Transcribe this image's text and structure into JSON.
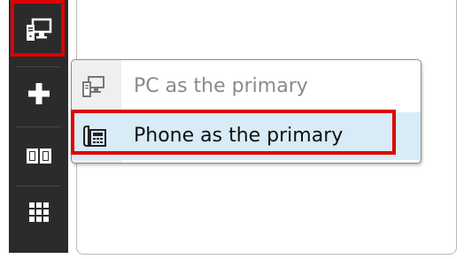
{
  "toolbar": {
    "items": [
      {
        "icon": "monitor-icon",
        "selected": true
      },
      {
        "icon": "plus-icon"
      },
      {
        "icon": "book-icon"
      },
      {
        "icon": "grid-icon"
      }
    ],
    "background": "#2b2b2b",
    "highlight_color": "#e00000"
  },
  "menu": {
    "items": [
      {
        "label": "PC as the primary",
        "icon": "pc-icon",
        "enabled": false
      },
      {
        "label": "Phone as the primary",
        "icon": "phone-icon",
        "hovered": true
      }
    ],
    "hover_color": "#d8ebf7",
    "disabled_text_color": "#8a8a8a"
  }
}
